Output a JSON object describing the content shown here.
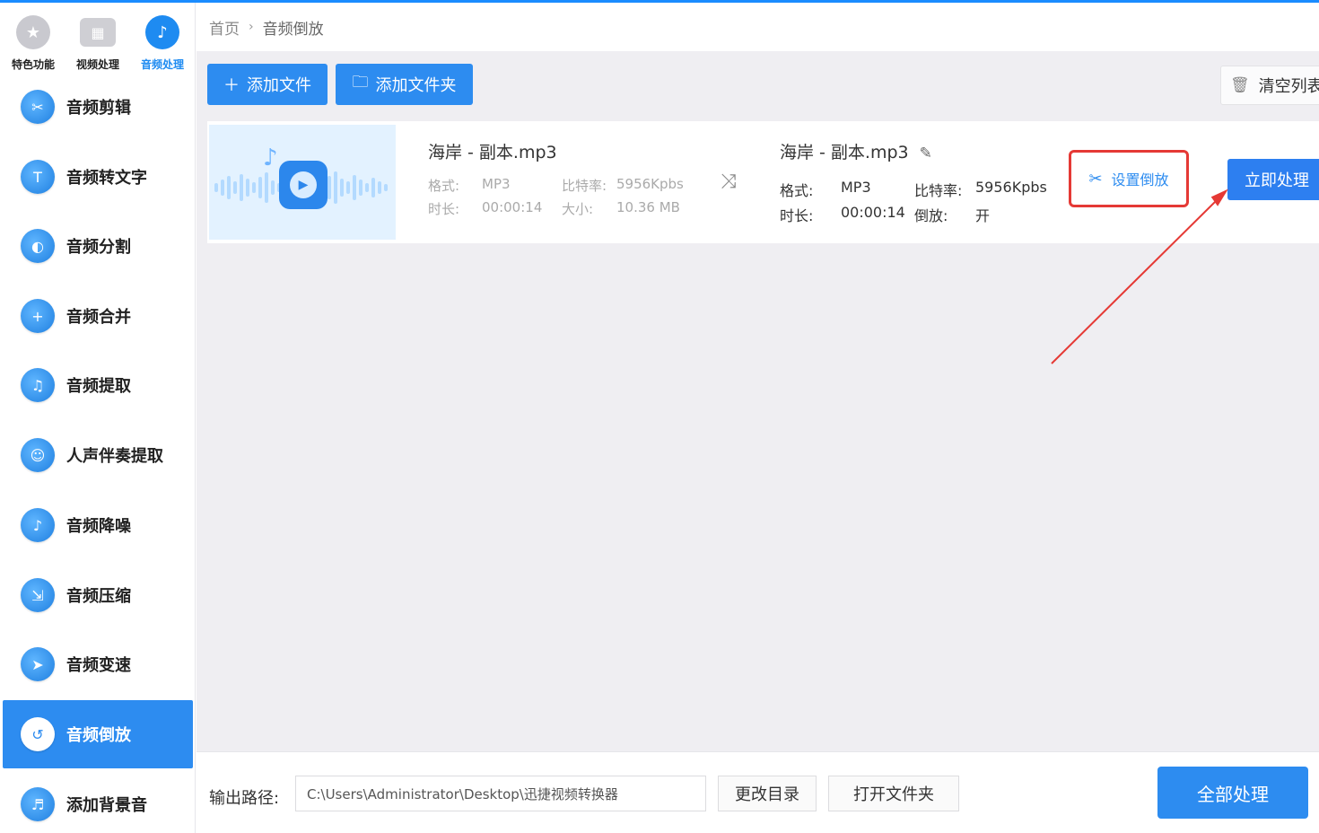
{
  "categories": [
    {
      "label": "特色功能",
      "icon": "star-icon",
      "active": false
    },
    {
      "label": "视频处理",
      "icon": "film-icon",
      "active": false
    },
    {
      "label": "音频处理",
      "icon": "music-icon",
      "active": true
    }
  ],
  "menu": [
    {
      "label": "音频剪辑",
      "active": false
    },
    {
      "label": "音频转文字",
      "active": false
    },
    {
      "label": "音频分割",
      "active": false
    },
    {
      "label": "音频合并",
      "active": false
    },
    {
      "label": "音频提取",
      "active": false
    },
    {
      "label": "人声伴奏提取",
      "active": false
    },
    {
      "label": "音频降噪",
      "active": false
    },
    {
      "label": "音频压缩",
      "active": false
    },
    {
      "label": "音频变速",
      "active": false
    },
    {
      "label": "音频倒放",
      "active": true
    },
    {
      "label": "添加背景音",
      "active": false
    }
  ],
  "breadcrumb": {
    "home": "首页",
    "current": "音频倒放"
  },
  "toolbar": {
    "add_file": "添加文件",
    "add_folder": "添加文件夹",
    "clear_list": "清空列表"
  },
  "file": {
    "source": {
      "name": "海岸 - 副本.mp3",
      "format_label": "格式:",
      "format": "MP3",
      "bitrate_label": "比特率:",
      "bitrate": "5956Kpbs",
      "duration_label": "时长:",
      "duration": "00:00:14",
      "size_label": "大小:",
      "size": "10.36 MB"
    },
    "output": {
      "name": "海岸 - 副本.mp3",
      "format_label": "格式:",
      "format": "MP3",
      "bitrate_label": "比特率:",
      "bitrate": "5956Kpbs",
      "duration_label": "时长:",
      "duration": "00:00:14",
      "reverse_label": "倒放:",
      "reverse": "开"
    },
    "setting_button": "设置倒放",
    "process_button": "立即处理"
  },
  "footer": {
    "output_label": "输出路径:",
    "output_path": "C:\\Users\\Administrator\\Desktop\\迅捷视频转换器",
    "change_dir": "更改目录",
    "open_folder": "打开文件夹",
    "process_all": "全部处理"
  },
  "colors": {
    "accent": "#2d8cf0",
    "highlight": "#e53935",
    "background": "#efeef2"
  }
}
